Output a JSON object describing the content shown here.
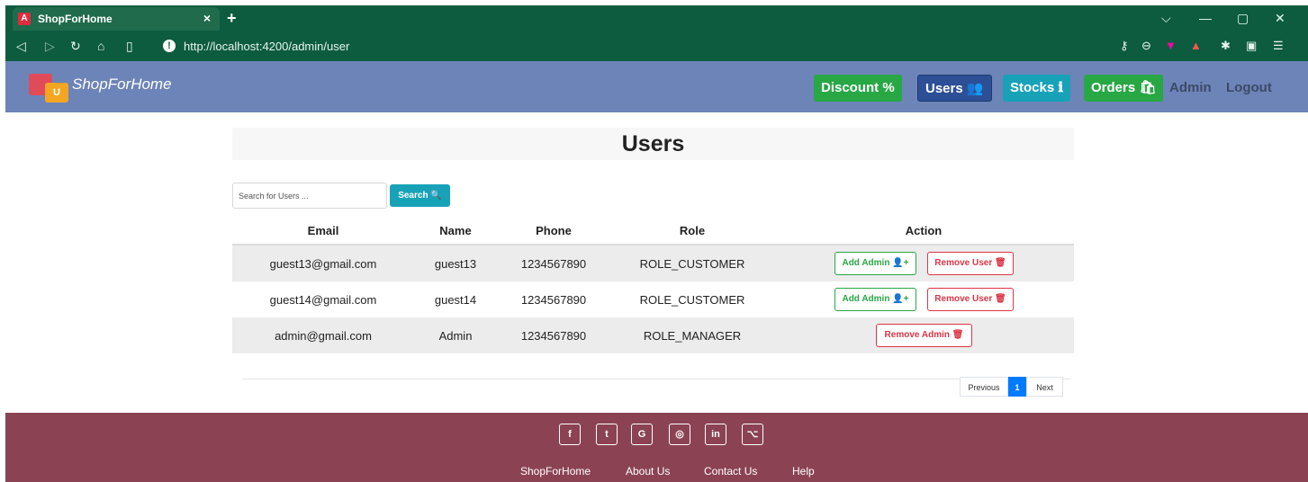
{
  "browser": {
    "tab_title": "ShopForHome",
    "tab_close": "×",
    "new_tab": "+",
    "url": "http://localhost:4200/admin/user"
  },
  "navbar": {
    "brand": "ShopForHome",
    "logo_letter": "U",
    "discount": "Discount %",
    "users": "Users",
    "stocks": "Stocks ℹ",
    "orders": "Orders",
    "admin": "Admin",
    "logout": "Logout",
    "colors": {
      "discount": "#28a745",
      "users": "#2c4f95",
      "stocks": "#17a2b8",
      "orders": "#28a745"
    }
  },
  "page": {
    "title": "Users",
    "search_placeholder": "Search for Users ...",
    "search_button": "Search"
  },
  "table": {
    "headers": [
      "Email",
      "Name",
      "Phone",
      "Role",
      "Action"
    ],
    "rows": [
      {
        "email": "guest13@gmail.com",
        "name": "guest13",
        "phone": "1234567890",
        "role": "ROLE_CUSTOMER",
        "add_admin": "Add Admin",
        "remove": "Remove User"
      },
      {
        "email": "guest14@gmail.com",
        "name": "guest14",
        "phone": "1234567890",
        "role": "ROLE_CUSTOMER",
        "add_admin": "Add Admin",
        "remove": "Remove User"
      },
      {
        "email": "admin@gmail.com",
        "name": "Admin",
        "phone": "1234567890",
        "role": "ROLE_MANAGER",
        "remove": "Remove Admin"
      }
    ]
  },
  "pagination": {
    "previous": "Previous",
    "current": "1",
    "next": "Next"
  },
  "footer": {
    "social": [
      "f",
      "t",
      "G",
      "◎",
      "in",
      "⌥"
    ],
    "links": [
      "ShopForHome",
      "About Us",
      "Contact Us",
      "Help"
    ]
  }
}
